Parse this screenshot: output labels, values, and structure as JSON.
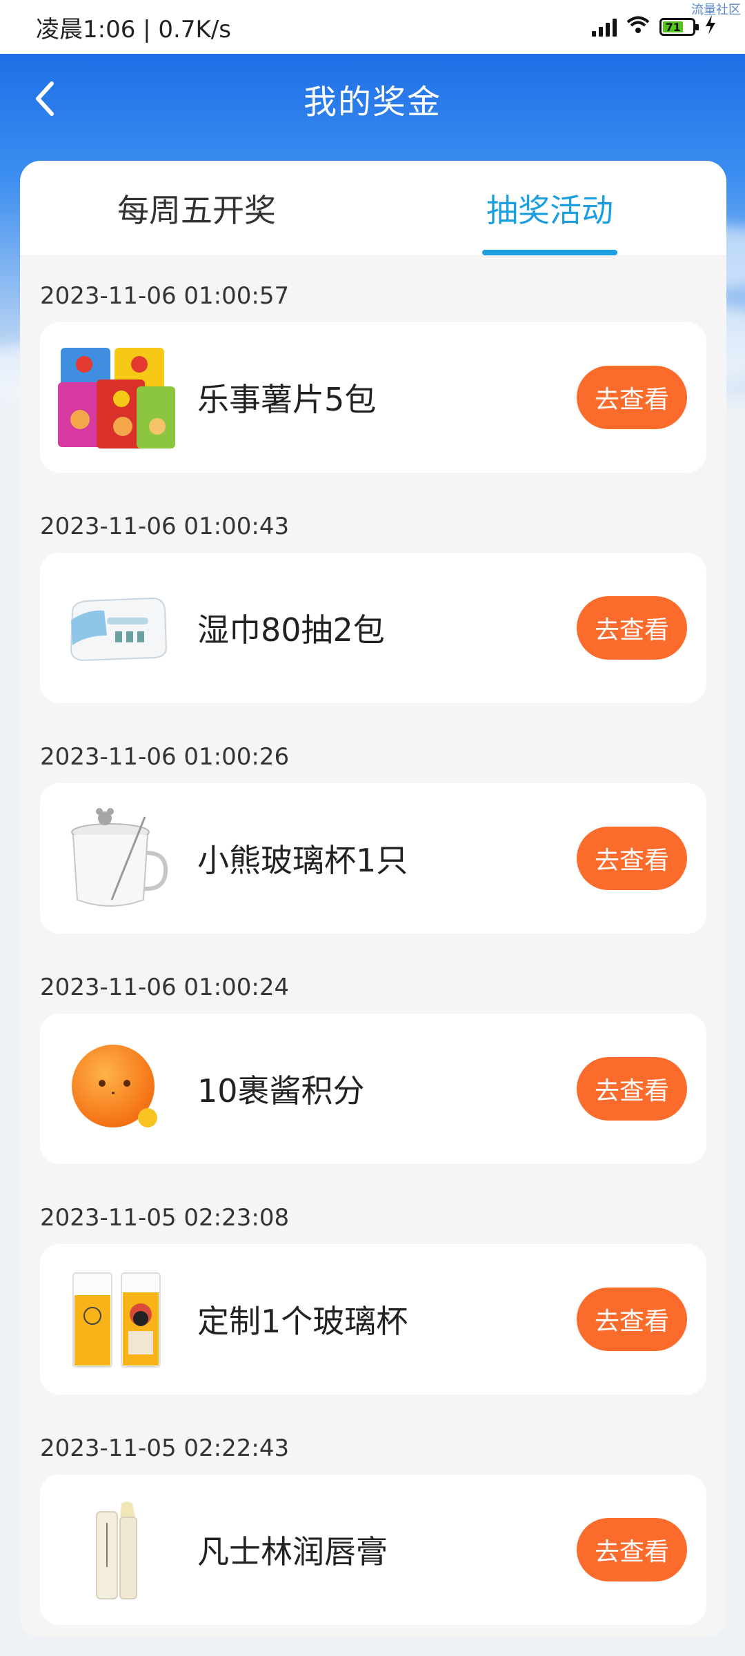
{
  "status_bar": {
    "time_speed": "凌晨1:06 | 0.7K/s",
    "battery": "71",
    "watermark": "流量社区"
  },
  "header": {
    "title": "我的奖金"
  },
  "tabs": [
    {
      "label": "每周五开奖"
    },
    {
      "label": "抽奖活动"
    }
  ],
  "active_tab": 1,
  "prizes": [
    {
      "time": "2023-11-06 01:00:57",
      "name": "乐事薯片5包",
      "button": "去查看",
      "icon": "chips-icon"
    },
    {
      "time": "2023-11-06 01:00:43",
      "name": "湿巾80抽2包",
      "button": "去查看",
      "icon": "wet-wipes-icon"
    },
    {
      "time": "2023-11-06 01:00:26",
      "name": "小熊玻璃杯1只",
      "button": "去查看",
      "icon": "glass-cup-icon"
    },
    {
      "time": "2023-11-06 01:00:24",
      "name": "10裹酱积分",
      "button": "去查看",
      "icon": "mascot-icon"
    },
    {
      "time": "2023-11-05 02:23:08",
      "name": "定制1个玻璃杯",
      "button": "去查看",
      "icon": "custom-glass-icon"
    },
    {
      "time": "2023-11-05 02:22:43",
      "name": "凡士林润唇膏",
      "button": "去查看",
      "icon": "lip-balm-icon"
    }
  ],
  "colors": {
    "accent_blue": "#1c9fe0",
    "button_orange": "#fb6c2c"
  }
}
